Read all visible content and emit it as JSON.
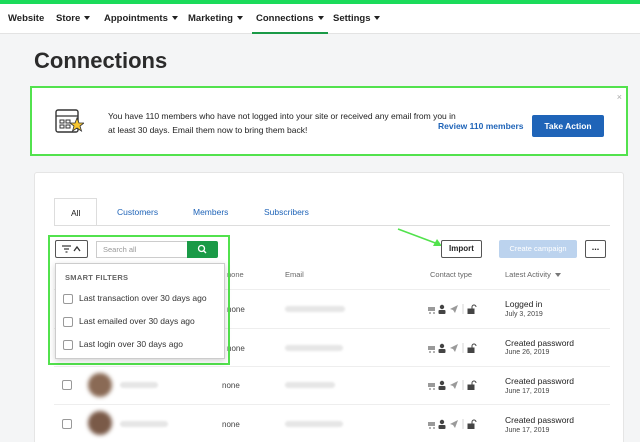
{
  "nav": {
    "items": [
      {
        "label": "Website",
        "dropdown": false
      },
      {
        "label": "Store",
        "dropdown": true
      },
      {
        "label": "Appointments",
        "dropdown": true
      },
      {
        "label": "Marketing",
        "dropdown": true
      },
      {
        "label": "Connections",
        "dropdown": true,
        "active": true
      },
      {
        "label": "Settings",
        "dropdown": true
      }
    ]
  },
  "page": {
    "title": "Connections"
  },
  "banner": {
    "message": "You have 110 members who have not logged into your site or received any email from you in at least 30 days. Email them now to bring them back!",
    "review_link": "Review 110 members",
    "action_button": "Take Action",
    "close_symbol": "×",
    "icon": "contact-card-star-icon"
  },
  "tabs": [
    {
      "label": "All",
      "active": true
    },
    {
      "label": "Customers"
    },
    {
      "label": "Members"
    },
    {
      "label": "Subscribers"
    }
  ],
  "toolbar": {
    "search_placeholder": "Search all",
    "import_label": "Import",
    "campaign_label": "Create campaign",
    "more_label": "..."
  },
  "smart_filters": {
    "title": "SMART FILTERS",
    "items": [
      "Last transaction over 30 days ago",
      "Last emailed over 30 days ago",
      "Last login over 30 days ago"
    ]
  },
  "table": {
    "headers": {
      "phone": "none",
      "email": "Email",
      "contact_type": "Contact type",
      "latest_activity": "Latest Activity"
    },
    "rows": [
      {
        "phone": "none",
        "activity": "Logged in",
        "date": "July 3, 2019"
      },
      {
        "phone": "none",
        "activity": "Created password",
        "date": "June 26, 2019"
      },
      {
        "phone": "none",
        "activity": "Created password",
        "date": "June 17, 2019"
      },
      {
        "phone": "none",
        "activity": "Created password",
        "date": "June 17, 2019"
      }
    ]
  },
  "colors": {
    "brand_green": "#1a9a47",
    "highlight_green": "#52e24d",
    "link_blue": "#1f64b8"
  }
}
